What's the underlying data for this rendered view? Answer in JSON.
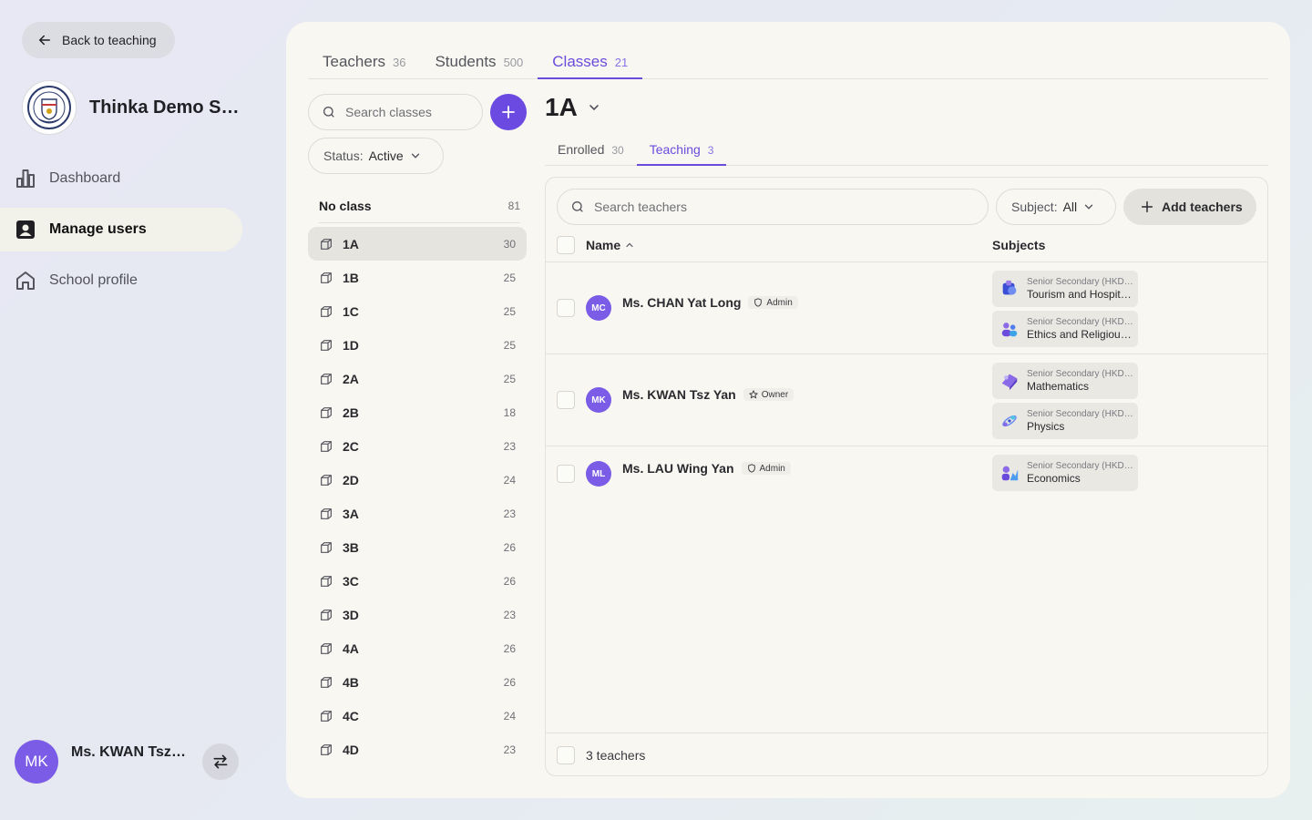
{
  "sidebar": {
    "back_label": "Back to teaching",
    "school_name": "Thinka Demo Secondary School",
    "nav": [
      {
        "label": "Dashboard",
        "icon": "bar-chart-icon"
      },
      {
        "label": "Manage users",
        "icon": "user-card-icon"
      },
      {
        "label": "School profile",
        "icon": "home-icon"
      }
    ],
    "active_nav": "Manage users",
    "user": {
      "initials": "MK",
      "name": "Ms. KWAN Tsz Yan"
    }
  },
  "top_tabs": [
    {
      "label": "Teachers",
      "count": "36"
    },
    {
      "label": "Students",
      "count": "500"
    },
    {
      "label": "Classes",
      "count": "21"
    }
  ],
  "classes_panel": {
    "search_placeholder": "Search classes",
    "status_label": "Status:",
    "status_value": "Active",
    "no_class": {
      "label": "No class",
      "count": "81"
    },
    "items": [
      {
        "label": "1A",
        "count": "30"
      },
      {
        "label": "1B",
        "count": "25"
      },
      {
        "label": "1C",
        "count": "25"
      },
      {
        "label": "1D",
        "count": "25"
      },
      {
        "label": "2A",
        "count": "25"
      },
      {
        "label": "2B",
        "count": "18"
      },
      {
        "label": "2C",
        "count": "23"
      },
      {
        "label": "2D",
        "count": "24"
      },
      {
        "label": "3A",
        "count": "23"
      },
      {
        "label": "3B",
        "count": "26"
      },
      {
        "label": "3C",
        "count": "26"
      },
      {
        "label": "3D",
        "count": "23"
      },
      {
        "label": "4A",
        "count": "26"
      },
      {
        "label": "4B",
        "count": "26"
      },
      {
        "label": "4C",
        "count": "24"
      },
      {
        "label": "4D",
        "count": "23"
      }
    ]
  },
  "detail": {
    "class_name": "1A",
    "sub_tabs": [
      {
        "label": "Enrolled",
        "count": "30"
      },
      {
        "label": "Teaching",
        "count": "3"
      }
    ],
    "search_placeholder": "Search teachers",
    "subject_label": "Subject:",
    "subject_value": "All",
    "add_label": "Add teachers",
    "col_name": "Name",
    "col_subjects": "Subjects",
    "teachers": [
      {
        "initials": "MC",
        "name": "Ms. CHAN Yat Long",
        "role": "Admin",
        "subjects": [
          {
            "level": "Senior Secondary (HKDSE)",
            "name": "Tourism and Hospitality Studies",
            "icon": "globe-3d-icon"
          },
          {
            "level": "Senior Secondary (HKDSE)",
            "name": "Ethics and Religious Studies",
            "icon": "people-3d-icon"
          }
        ]
      },
      {
        "initials": "MK",
        "name": "Ms. KWAN Tsz Yan",
        "role": "Owner",
        "subjects": [
          {
            "level": "Senior Secondary (HKDSE)",
            "name": "Mathematics",
            "icon": "math-3d-icon"
          },
          {
            "level": "Senior Secondary (HKDSE)",
            "name": "Physics",
            "icon": "atom-3d-icon"
          }
        ]
      },
      {
        "initials": "ML",
        "name": "Ms. LAU Wing Yan",
        "role": "Admin",
        "subjects": [
          {
            "level": "Senior Secondary (HKDSE)",
            "name": "Economics",
            "icon": "chart-3d-icon"
          }
        ]
      }
    ],
    "footer_label": "3 teachers"
  }
}
